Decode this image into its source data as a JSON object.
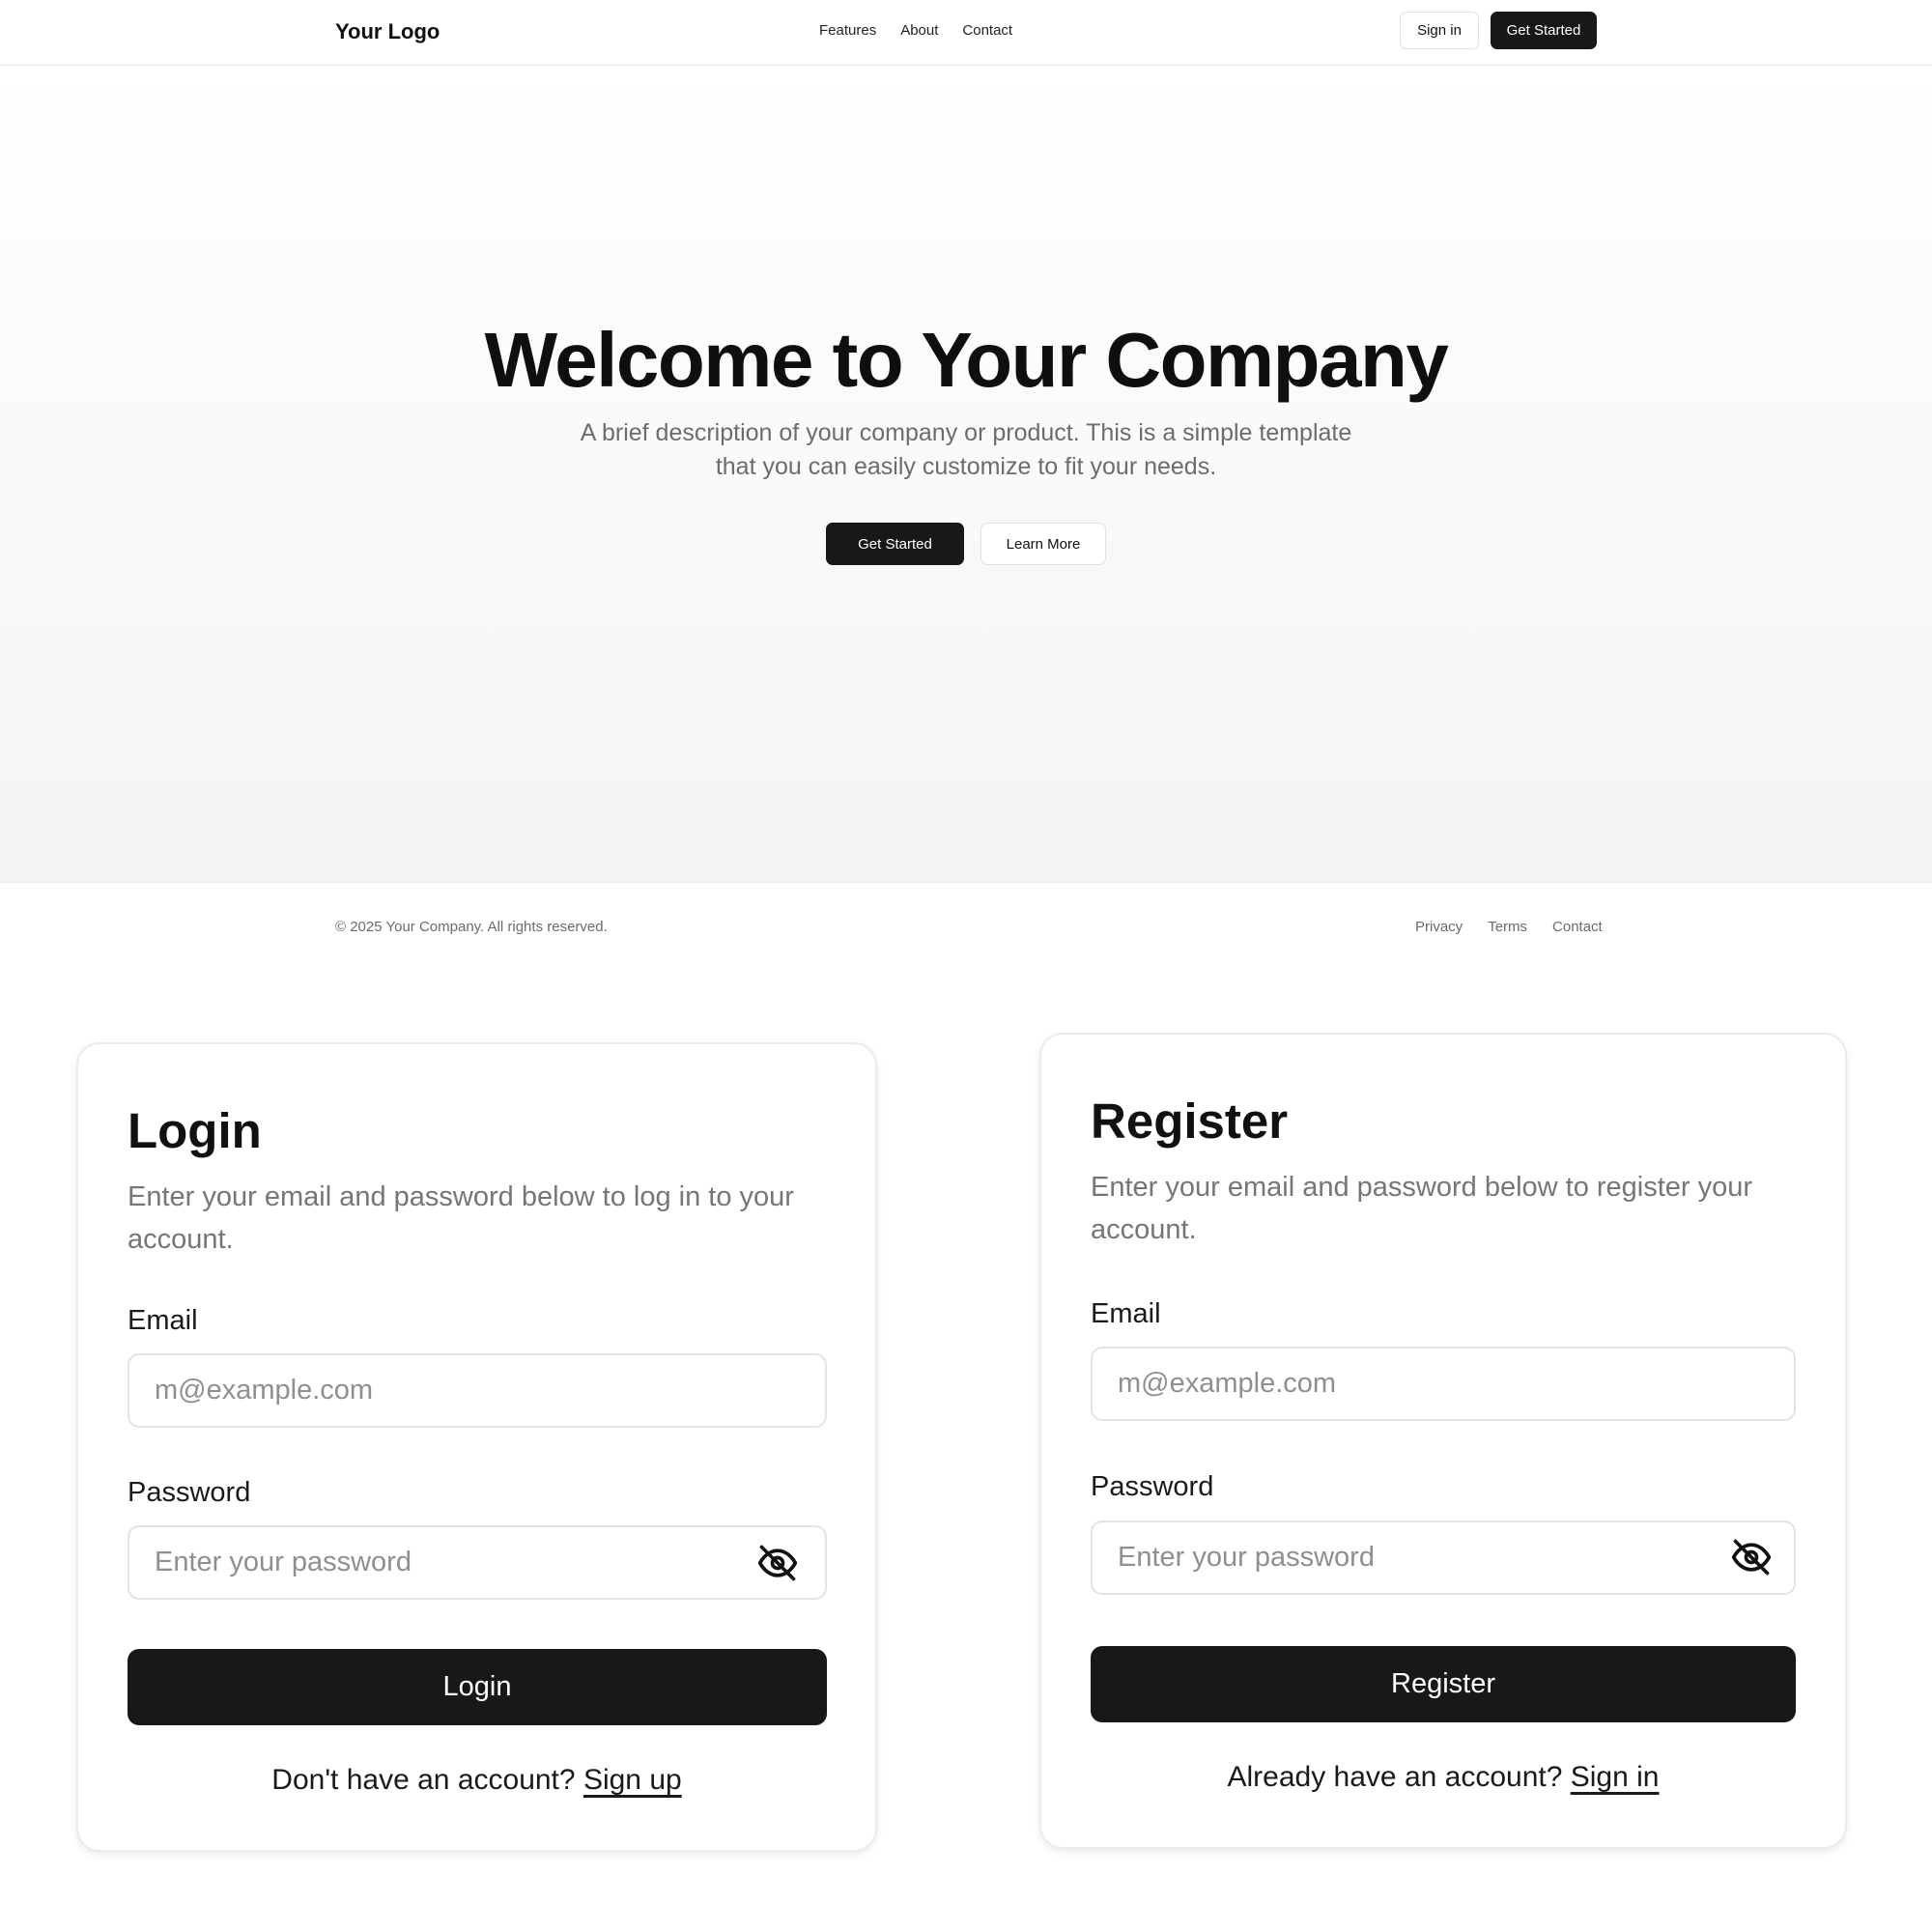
{
  "nav": {
    "logo": "Your Logo",
    "links": [
      "Features",
      "About",
      "Contact"
    ],
    "signin_label": "Sign in",
    "get_started_label": "Get Started"
  },
  "hero": {
    "title": "Welcome to Your Company",
    "description": "A brief description of your company or product. This is a simple template that you can easily customize to fit your needs.",
    "primary_label": "Get Started",
    "secondary_label": "Learn More"
  },
  "footer": {
    "copyright": "© 2025 Your Company. All rights reserved.",
    "links": [
      "Privacy",
      "Terms",
      "Contact"
    ]
  },
  "login": {
    "title": "Login",
    "description": "Enter your email and password below to log in to your account.",
    "email_label": "Email",
    "email_placeholder": "m@example.com",
    "password_label": "Password",
    "password_placeholder": "Enter your password",
    "submit_label": "Login",
    "switch_text": "Don't have an account?",
    "switch_link": "Sign up",
    "eye_icon": "eye-off-icon"
  },
  "register": {
    "title": "Register",
    "description": "Enter your email and password below to register your account.",
    "email_label": "Email",
    "email_placeholder": "m@example.com",
    "password_label": "Password",
    "password_placeholder": "Enter your password",
    "submit_label": "Register",
    "switch_text": "Already have an account?",
    "switch_link": "Sign in",
    "eye_icon": "eye-off-icon"
  },
  "colors": {
    "primary": "#18181b",
    "muted_text": "#6b6b70",
    "border": "#e3e3e3"
  }
}
